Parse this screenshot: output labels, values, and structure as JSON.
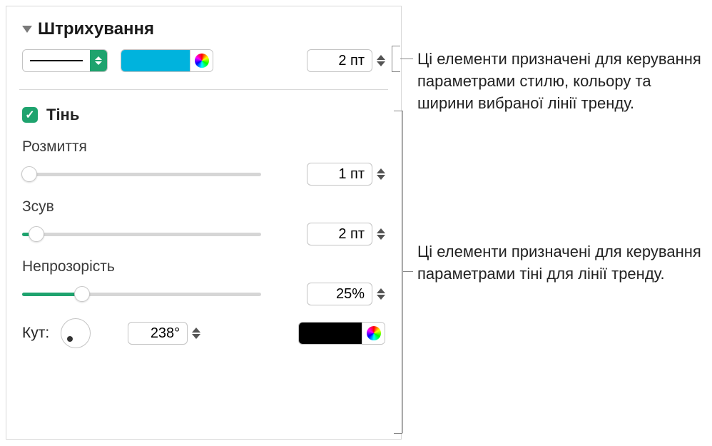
{
  "stroke": {
    "title": "Штрихування",
    "width_value": "2 пт",
    "color": "#00b3dd"
  },
  "shadow": {
    "checkbox_label": "Тінь",
    "checked": true,
    "blur": {
      "label": "Розмиття",
      "value": "1 пт",
      "percent": 3
    },
    "offset": {
      "label": "Зсув",
      "value": "2 пт",
      "percent": 6
    },
    "opacity": {
      "label": "Непрозорість",
      "value": "25%",
      "percent": 25
    },
    "angle": {
      "label": "Кут:",
      "value": "238°"
    },
    "color": "#000000"
  },
  "annotations": {
    "stroke_text": "Ці елементи призначені для керування параметрами стилю, кольору та ширини вибраної лінії тренду.",
    "shadow_text": "Ці елементи призначені для керування параметрами тіні для лінії тренду."
  }
}
